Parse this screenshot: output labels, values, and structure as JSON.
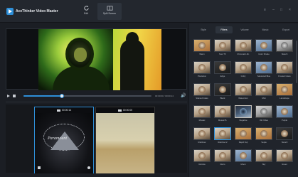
{
  "app": {
    "title": "AceThinker Video Master"
  },
  "modes": [
    {
      "label": "Edit",
      "icon": "refresh-icon"
    },
    {
      "label": "Split Screen",
      "icon": "split-screen-icon"
    }
  ],
  "player": {
    "timecode": "00:00:00 / 00:00:14",
    "progress": 0.3
  },
  "split": {
    "slot1": {
      "label": "00:00:14",
      "logo_text": "Paramount"
    },
    "slot2": {
      "label": "00:00:00"
    }
  },
  "tabs": [
    "Style",
    "Filters",
    "Volume",
    "Music",
    "Export"
  ],
  "active_tab": 1,
  "filters": [
    {
      "name": "Warm",
      "style": "warm"
    },
    {
      "name": "Soul TV",
      "style": ""
    },
    {
      "name": "Chromatic Ab.",
      "style": ""
    },
    {
      "name": "Color Shade",
      "style": "cool"
    },
    {
      "name": "Sketch",
      "style": "gray"
    },
    {
      "name": "Pixelation",
      "style": ""
    },
    {
      "name": "Edge",
      "style": "dark"
    },
    {
      "name": "Gritty",
      "style": ""
    },
    {
      "name": "Saturated Blue",
      "style": "cool"
    },
    {
      "name": "Frosted Glass",
      "style": ""
    },
    {
      "name": "Stained Glass",
      "style": ""
    },
    {
      "name": "Black",
      "style": "dark"
    },
    {
      "name": "Watercolor",
      "style": ""
    },
    {
      "name": "Mist",
      "style": ""
    },
    {
      "name": "Landscape",
      "style": "warm"
    },
    {
      "name": "Mosaic",
      "style": ""
    },
    {
      "name": "Mosaic B.",
      "style": ""
    },
    {
      "name": "Negative",
      "style": "neg"
    },
    {
      "name": "Old Video",
      "style": "gray"
    },
    {
      "name": "Purple",
      "style": "cool"
    },
    {
      "name": "Rainbow",
      "style": ""
    },
    {
      "name": "Rainbow 2",
      "style": "",
      "selected": true
    },
    {
      "name": "Rapid Fuji",
      "style": "warm"
    },
    {
      "name": "Sepia",
      "style": "warm"
    },
    {
      "name": "Stencil",
      "style": "dark"
    },
    {
      "name": "Retrola",
      "style": ""
    },
    {
      "name": "Retro",
      "style": ""
    },
    {
      "name": "Moon",
      "style": "cool"
    },
    {
      "name": "Sky",
      "style": ""
    },
    {
      "name": "Green",
      "style": ""
    }
  ]
}
